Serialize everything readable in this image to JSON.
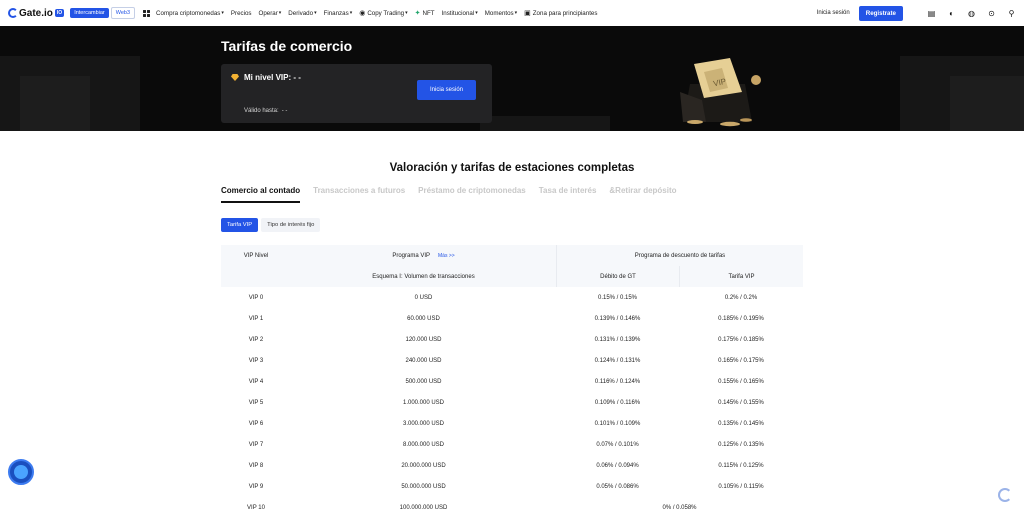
{
  "nav": {
    "logo_text": "Gate.io",
    "logo_badge": "IO",
    "pill_exchange": "Intercambiar",
    "pill_web3": "Web3",
    "items": [
      {
        "label": "Compra criptomonedas",
        "caret": true
      },
      {
        "label": "Precios",
        "caret": false
      },
      {
        "label": "Operar",
        "caret": true
      },
      {
        "label": "Derivado",
        "caret": true
      },
      {
        "label": "Finanzas",
        "caret": true
      },
      {
        "label": "Copy Trading",
        "caret": true
      },
      {
        "label": "NFT",
        "caret": false
      },
      {
        "label": "Institucional",
        "caret": true
      },
      {
        "label": "Momentos",
        "caret": true
      },
      {
        "label": "Zona para principiantes",
        "caret": false
      }
    ],
    "login": "Inicia sesión",
    "register": "Registrate"
  },
  "hero": {
    "title": "Tarifas de comercio",
    "vip_label": "Mi nivel VIP: - -",
    "login_button": "Inicia sesión",
    "valid_label": "Válido hasta:",
    "valid_value": "- -",
    "box_text": "VIP"
  },
  "section_title": "Valoración y tarifas de estaciones completas",
  "tabs": [
    "Comercio al contado",
    "Transacciones a futuros",
    "Préstamo de criptomonedas",
    "Tasa de interés",
    "&Retirar depósito"
  ],
  "subtabs": [
    "Tarifa VIP",
    "Tipo de interés fijo"
  ],
  "table": {
    "h_level": "VIP Nivel",
    "h_program": "Programa VIP",
    "h_more": "Más >>",
    "h_discount": "Programa de descuento de tarifas",
    "h_scheme": "Esquema I: Volumen de transacciones",
    "h_gt": "Débito de GT",
    "h_vip": "Tarifa VIP",
    "rows": [
      {
        "level": "VIP 0",
        "volume": "0 USD",
        "gt": "0.15% / 0.15%",
        "vip": "0.2% / 0.2%"
      },
      {
        "level": "VIP 1",
        "volume": "60.000 USD",
        "gt": "0.139% / 0.146%",
        "vip": "0.185% / 0.195%"
      },
      {
        "level": "VIP 2",
        "volume": "120.000 USD",
        "gt": "0.131% / 0.139%",
        "vip": "0.175% / 0.185%"
      },
      {
        "level": "VIP 3",
        "volume": "240.000 USD",
        "gt": "0.124% / 0.131%",
        "vip": "0.165% / 0.175%"
      },
      {
        "level": "VIP 4",
        "volume": "500.000 USD",
        "gt": "0.116% / 0.124%",
        "vip": "0.155% / 0.165%"
      },
      {
        "level": "VIP 5",
        "volume": "1.000.000 USD",
        "gt": "0.109% / 0.116%",
        "vip": "0.145% / 0.155%"
      },
      {
        "level": "VIP 6",
        "volume": "3.000.000 USD",
        "gt": "0.101% / 0.109%",
        "vip": "0.135% / 0.145%"
      },
      {
        "level": "VIP 7",
        "volume": "8.000.000 USD",
        "gt": "0.07% / 0.101%",
        "vip": "0.125% / 0.135%"
      },
      {
        "level": "VIP 8",
        "volume": "20.000.000 USD",
        "gt": "0.06% / 0.094%",
        "vip": "0.115% / 0.125%"
      },
      {
        "level": "VIP 9",
        "volume": "50.000.000 USD",
        "gt": "0.05% / 0.086%",
        "vip": "0.105% / 0.115%"
      },
      {
        "level": "VIP 10",
        "volume": "100.000.000 USD",
        "merged": "0% / 0.058%"
      }
    ]
  }
}
